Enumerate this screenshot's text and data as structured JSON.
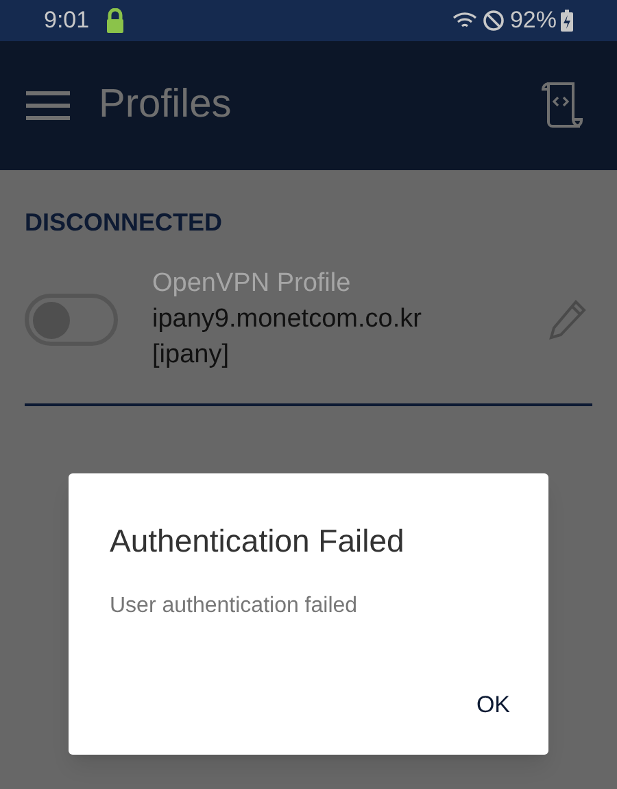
{
  "status_bar": {
    "time": "9:01",
    "battery": "92%"
  },
  "app_bar": {
    "title": "Profiles"
  },
  "section": {
    "title": "DISCONNECTED"
  },
  "profiles": [
    {
      "name": "OpenVPN Profile",
      "server": "ipany9.monetcom.co.kr",
      "user": "[ipany]",
      "on": false
    }
  ],
  "dialog": {
    "title": "Authentication Failed",
    "message": "User authentication failed",
    "buttons": [
      "OK"
    ]
  }
}
